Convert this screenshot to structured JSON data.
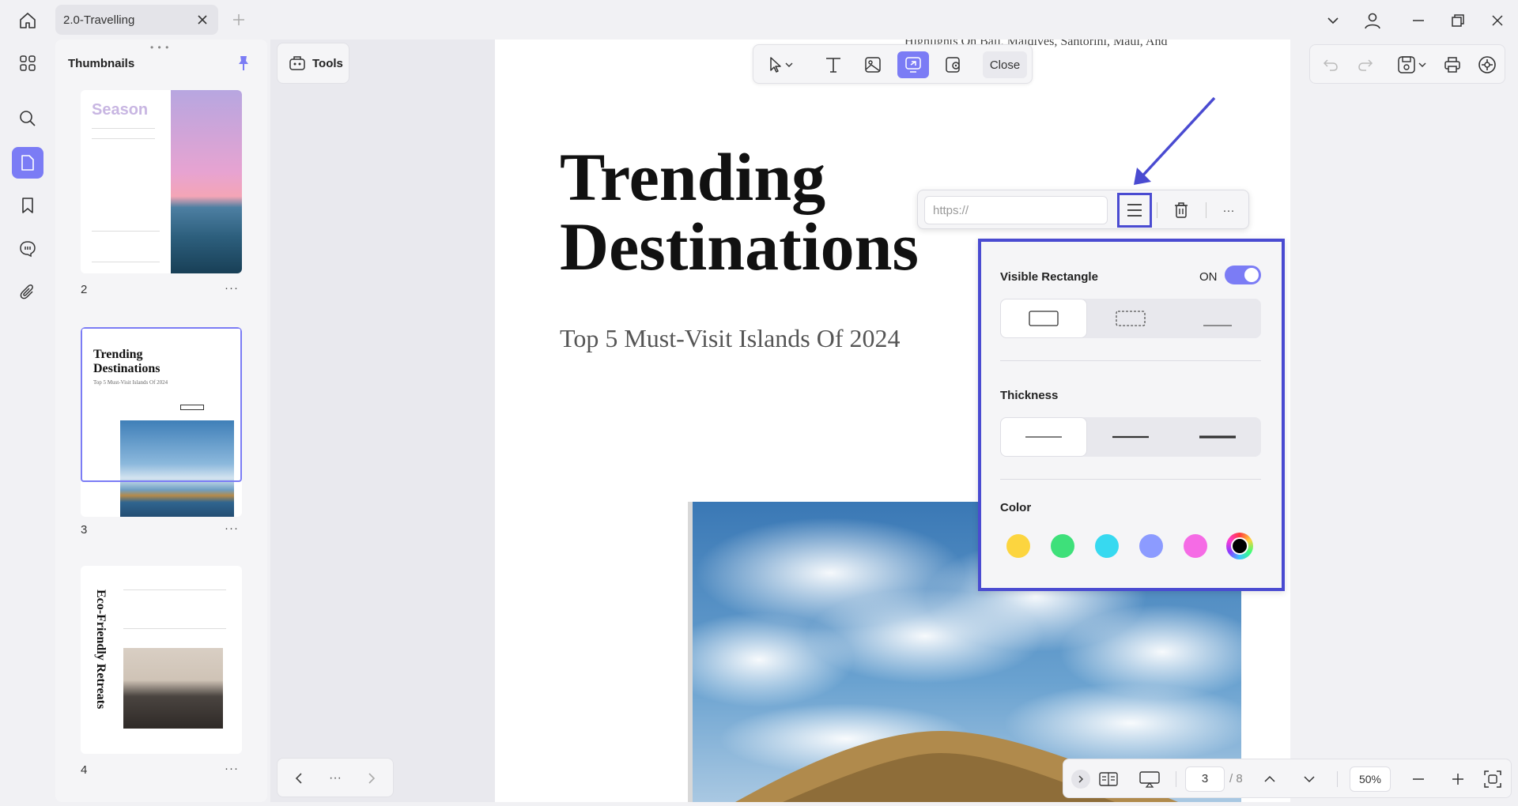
{
  "tab": {
    "title": "2.0-Travelling"
  },
  "thumbnails": {
    "title": "Thumbnails",
    "pages": [
      {
        "number": "2",
        "heading": "Season",
        "selected": false
      },
      {
        "number": "3",
        "heading_line1": "Trending",
        "heading_line2": "Destinations",
        "subheading": "Top 5 Must-Visit Islands Of 2024",
        "selected": true
      },
      {
        "number": "4",
        "heading": "Eco-Friendly Retreats",
        "selected": false
      }
    ],
    "more_label": "···"
  },
  "tools": {
    "label": "Tools"
  },
  "pager_nav": {
    "more": "···"
  },
  "document": {
    "top_text": "Highlights On Bali, Maldives, Santorini, Maui, And",
    "title_line1": "Trending",
    "title_line2": "Destinations",
    "subtitle": "Top 5 Must-Visit Islands Of 2024"
  },
  "edit_toolbar": {
    "close_label": "Close",
    "tools": [
      "select-arrow-icon",
      "text-icon",
      "image-icon",
      "link-icon",
      "location-icon"
    ],
    "active_tool": "link-icon"
  },
  "link_bar": {
    "url_placeholder": "https://",
    "more_label": "···"
  },
  "properties": {
    "visible_rectangle_label": "Visible Rectangle",
    "toggle_text": "ON",
    "toggle_on": true,
    "rect_styles": [
      "solid",
      "dashed",
      "underline"
    ],
    "rect_selected": "solid",
    "thickness_label": "Thickness",
    "thickness_options": [
      "thin",
      "medium",
      "thick"
    ],
    "thickness_selected": "thin",
    "color_label": "Color",
    "colors": [
      "#fcd53f",
      "#3ee07a",
      "#37d9f0",
      "#8c9bff",
      "#f56be5",
      "#000000"
    ],
    "color_selected": "#000000"
  },
  "statusbar": {
    "page_current": "3",
    "page_total": "/ 8",
    "zoom": "50%"
  },
  "colors": {
    "accent": "#7b7cf5",
    "annotation_blue": "#4a4bd1"
  }
}
